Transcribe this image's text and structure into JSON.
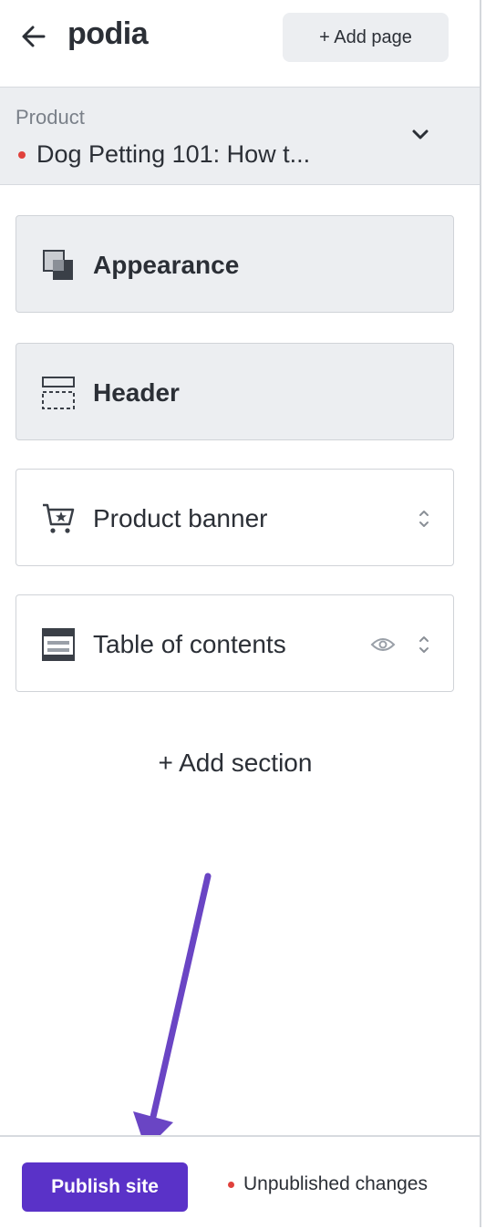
{
  "header": {
    "logo": "podia",
    "add_page_label": "+ Add page"
  },
  "product_select": {
    "label": "Product",
    "value": "Dog Petting 101: How t..."
  },
  "sections": [
    {
      "label": "Appearance",
      "icon": "appearance-icon"
    },
    {
      "label": "Header",
      "icon": "header-layout-icon"
    },
    {
      "label": "Product banner",
      "icon": "cart-star-icon"
    },
    {
      "label": "Table of contents",
      "icon": "table-of-contents-icon"
    }
  ],
  "add_section_label": "+ Add section",
  "footer": {
    "publish_label": "Publish site",
    "status_text": "Unpublished changes"
  },
  "colors": {
    "accent": "#5a32c8",
    "arrow": "#6a45c4",
    "status_dot": "#e0413c",
    "panel_gray": "#eceef1"
  }
}
